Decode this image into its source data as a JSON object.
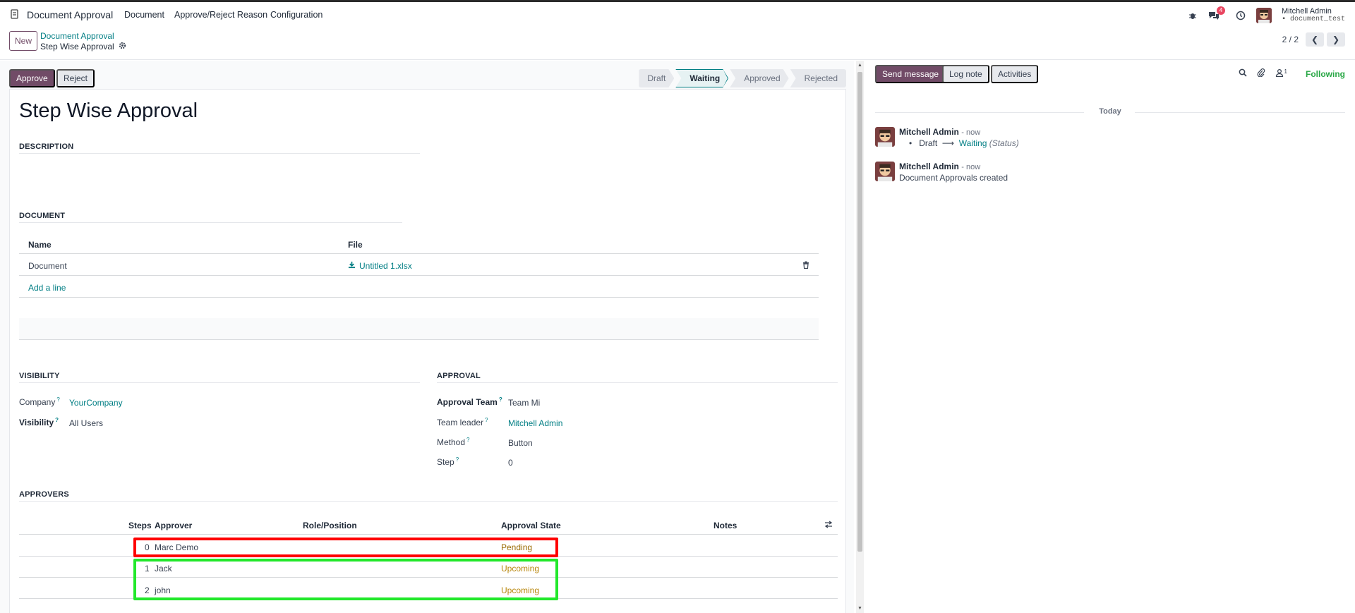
{
  "navbar": {
    "brand": "Document Approval",
    "menus": [
      "Document",
      "Approve/Reject Reason",
      "Configuration"
    ],
    "messages_badge": "4",
    "user_name": "Mitchell Admin",
    "database": "document_test"
  },
  "control_panel": {
    "new_label": "New",
    "breadcrumb_parent": "Document Approval",
    "breadcrumb_current": "Step Wise Approval",
    "pager_value": "2 / 2"
  },
  "statusbar": {
    "approve_label": "Approve",
    "reject_label": "Reject",
    "stages": [
      "Draft",
      "Waiting",
      "Approved",
      "Rejected"
    ],
    "active_stage": "Waiting"
  },
  "form": {
    "title": "Step Wise Approval",
    "description_label": "DESCRIPTION",
    "document_label": "DOCUMENT",
    "doc_table": {
      "headers": [
        "Name",
        "File"
      ],
      "rows": [
        {
          "name": "Document",
          "file": "Untitled 1.xlsx"
        }
      ],
      "add_line": "Add a line"
    },
    "visibility_label": "VISIBILITY",
    "company_label": "Company",
    "company_value": "YourCompany",
    "visibility_field_label": "Visibility",
    "visibility_value": "All Users",
    "approval_label": "APPROVAL",
    "approval_team_label": "Approval Team",
    "approval_team_value": "Team Mi",
    "team_leader_label": "Team leader",
    "team_leader_value": "Mitchell Admin",
    "method_label": "Method",
    "method_value": "Button",
    "step_label": "Step",
    "step_value": "0",
    "approvers_label": "APPROVERS",
    "approvers_table": {
      "headers": [
        "Steps",
        "Approver",
        "Role/Position",
        "Approval State",
        "Notes"
      ],
      "rows": [
        {
          "step": "0",
          "approver": "Marc Demo",
          "role": "",
          "state": "Pending"
        },
        {
          "step": "1",
          "approver": "Jack",
          "role": "",
          "state": "Upcoming"
        },
        {
          "step": "2",
          "approver": "john",
          "role": "",
          "state": "Upcoming"
        }
      ]
    }
  },
  "chatter": {
    "send_message": "Send message",
    "log_note": "Log note",
    "activities": "Activities",
    "followers_count": "1",
    "following": "Following",
    "date_separator": "Today",
    "messages": [
      {
        "author": "Mitchell Admin",
        "date": "- now",
        "tracking_old": "Draft",
        "tracking_new": "Waiting",
        "tracking_field": "(Status)"
      },
      {
        "author": "Mitchell Admin",
        "date": "- now",
        "body": "Document Approvals created"
      }
    ]
  },
  "colors": {
    "primary": "#714b67",
    "link": "#017e84",
    "highlight_red": "#ff0000",
    "highlight_green": "#22e82b",
    "following": "#28a745"
  }
}
